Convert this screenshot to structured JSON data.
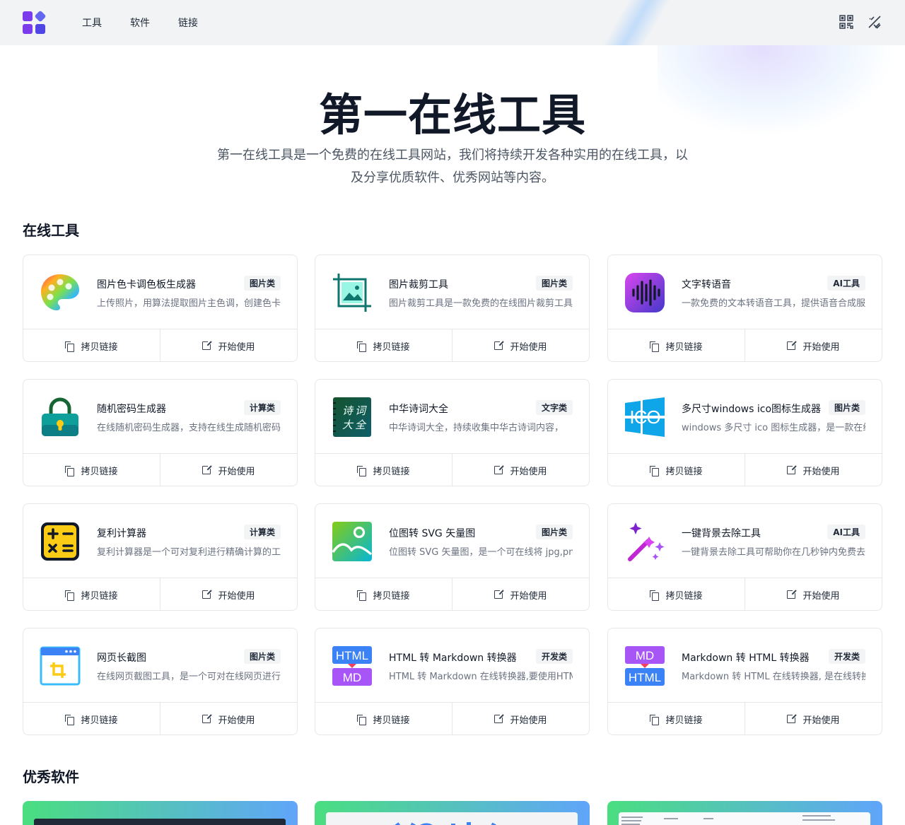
{
  "nav": [
    "工具",
    "软件",
    "链接"
  ],
  "hero": {
    "title": "第一在线工具",
    "desc_line1": "第一在线工具是一个免费的在线工具网站，我们将持续开发各种实用的在线工具，以",
    "desc_line2": "及分享优质软件、优秀网站等内容。"
  },
  "sections": {
    "tools": "在线工具",
    "software": "优秀软件"
  },
  "actions": {
    "copy": "拷贝链接",
    "open": "开始使用"
  },
  "tools": [
    {
      "name": "图片色卡调色板生成器",
      "tag": "图片类",
      "desc": "上传照片，用算法提取图片主色调，创建色卡调色板",
      "icon": "palette-icon"
    },
    {
      "name": "图片裁剪工具",
      "tag": "图片类",
      "desc": "图片裁剪工具是一款免费的在线图片裁剪工具",
      "icon": "image-crop-icon"
    },
    {
      "name": "文字转语音",
      "tag": "AI工具",
      "desc": "一款免费的文本转语音工具，提供语音合成服务",
      "icon": "soundwave-icon"
    },
    {
      "name": "随机密码生成器",
      "tag": "计算类",
      "desc": "在线随机密码生成器，支持在线生成随机密码",
      "icon": "lock-icon"
    },
    {
      "name": "中华诗词大全",
      "tag": "文字类",
      "desc": "中华诗词大全，持续收集中华古诗词内容，",
      "icon": "poetry-book-icon"
    },
    {
      "name": "多尺寸windows ico图标生成器",
      "tag": "图片类",
      "desc": "windows 多尺寸 ico 图标生成器，是一款在线工具",
      "icon": "windows-ico-icon"
    },
    {
      "name": "复利计算器",
      "tag": "计算类",
      "desc": "复利计算器是一个可对复利进行精确计算的工具",
      "icon": "calculator-icon"
    },
    {
      "name": "位图转 SVG 矢量图",
      "tag": "图片类",
      "desc": "位图转 SVG 矢量图，是一个可在线将 jpg,png 转换",
      "icon": "image-svg-icon"
    },
    {
      "name": "一键背景去除工具",
      "tag": "AI工具",
      "desc": "一键背景去除工具可帮助你在几秒钟内免费去除背景",
      "icon": "magic-wand-icon"
    },
    {
      "name": "网页长截图",
      "tag": "图片类",
      "desc": "在线网页截图工具，是一个可对在线网页进行截图",
      "icon": "screenshot-icon"
    },
    {
      "name": "HTML 转 Markdown 转换器",
      "tag": "开发类",
      "desc": "HTML 转 Markdown 在线转换器,要使用HTML",
      "icon": "html-md-icon"
    },
    {
      "name": "Markdown 转 HTML 转换器",
      "tag": "开发类",
      "desc": "Markdown 转 HTML 在线转换器, 是在线转换工具",
      "icon": "md-html-icon"
    }
  ],
  "icon_text": {
    "poetry": [
      "诗",
      "词",
      "大",
      "全"
    ],
    "ico": "ICO",
    "html": "HTML",
    "md": "MD"
  }
}
